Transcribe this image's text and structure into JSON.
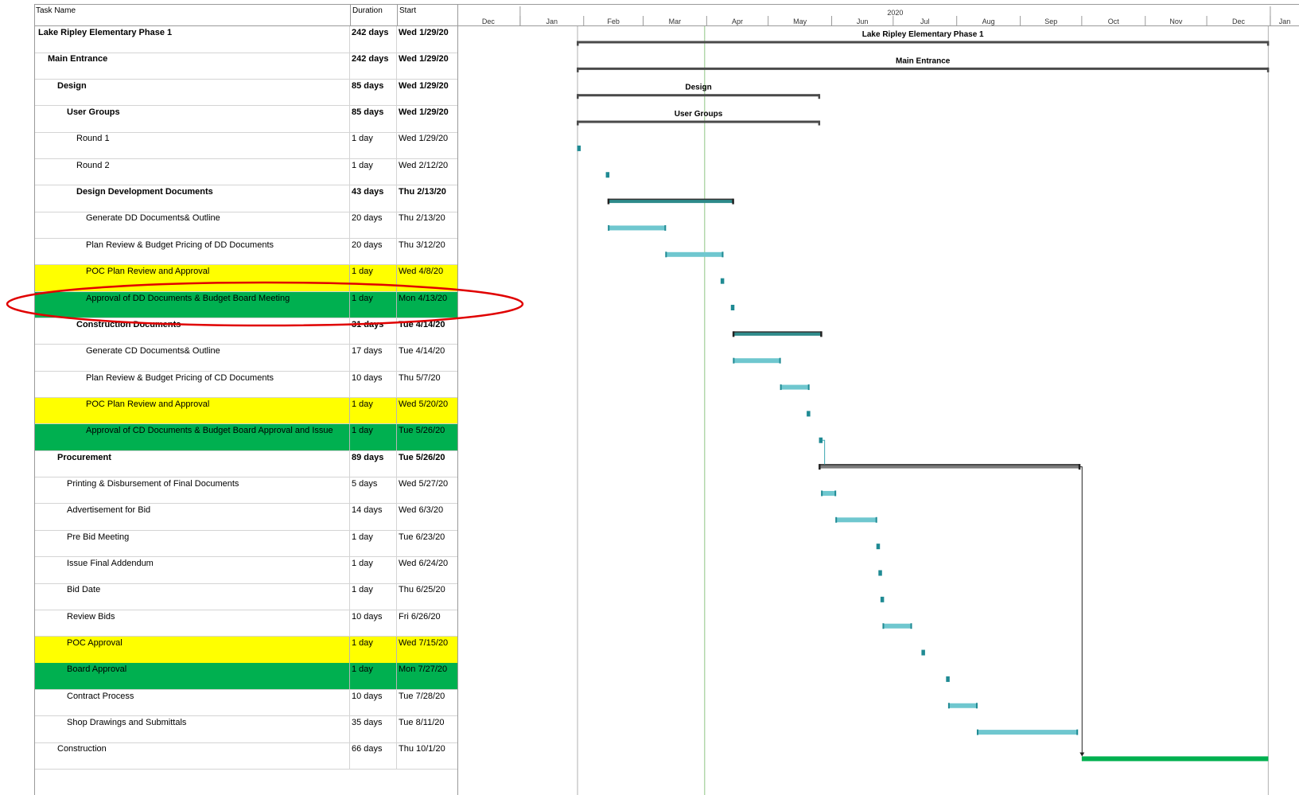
{
  "table": {
    "columns": {
      "name": "Task Name",
      "duration": "Duration",
      "start": "Start"
    },
    "rows": [
      {
        "name": "Lake Ripley Elementary Phase 1",
        "duration": "242 days",
        "start": "Wed 1/29/20",
        "level": 0,
        "bold": true,
        "highlight": ""
      },
      {
        "name": "Main Entrance",
        "duration": "242 days",
        "start": "Wed 1/29/20",
        "level": 1,
        "bold": true,
        "highlight": ""
      },
      {
        "name": "Design",
        "duration": "85 days",
        "start": "Wed 1/29/20",
        "level": 2,
        "bold": true,
        "highlight": ""
      },
      {
        "name": "User Groups",
        "duration": "85 days",
        "start": "Wed 1/29/20",
        "level": 3,
        "bold": true,
        "highlight": ""
      },
      {
        "name": "Round 1",
        "duration": "1 day",
        "start": "Wed 1/29/20",
        "level": 4,
        "bold": false,
        "highlight": ""
      },
      {
        "name": "Round 2",
        "duration": "1 day",
        "start": "Wed 2/12/20",
        "level": 4,
        "bold": false,
        "highlight": ""
      },
      {
        "name": "Design Development Documents",
        "duration": "43 days",
        "start": "Thu 2/13/20",
        "level": 4,
        "bold": true,
        "highlight": ""
      },
      {
        "name": "Generate DD Documents& Outline",
        "duration": "20 days",
        "start": "Thu 2/13/20",
        "level": 5,
        "bold": false,
        "highlight": ""
      },
      {
        "name": "Plan Review & Budget Pricing of DD Documents",
        "duration": "20 days",
        "start": "Thu 3/12/20",
        "level": 5,
        "bold": false,
        "highlight": ""
      },
      {
        "name": "POC Plan Review and Approval",
        "duration": "1 day",
        "start": "Wed 4/8/20",
        "level": 5,
        "bold": false,
        "highlight": "yellow"
      },
      {
        "name": "Approval of DD Documents & Budget Board Meeting",
        "duration": "1 day",
        "start": "Mon 4/13/20",
        "level": 5,
        "bold": false,
        "highlight": "green"
      },
      {
        "name": "Construction Documents",
        "duration": "31 days",
        "start": "Tue 4/14/20",
        "level": 4,
        "bold": true,
        "highlight": ""
      },
      {
        "name": "Generate CD Documents& Outline",
        "duration": "17 days",
        "start": "Tue 4/14/20",
        "level": 5,
        "bold": false,
        "highlight": ""
      },
      {
        "name": "Plan Review & Budget Pricing of CD Documents",
        "duration": "10 days",
        "start": "Thu 5/7/20",
        "level": 5,
        "bold": false,
        "highlight": ""
      },
      {
        "name": "POC Plan Review and Approval",
        "duration": "1 day",
        "start": "Wed 5/20/20",
        "level": 5,
        "bold": false,
        "highlight": "yellow"
      },
      {
        "name": "Approval of CD Documents & Budget Board Approval and Issue",
        "duration": "1 day",
        "start": "Tue 5/26/20",
        "level": 5,
        "bold": false,
        "highlight": "green"
      },
      {
        "name": "Procurement",
        "duration": "89 days",
        "start": "Tue 5/26/20",
        "level": 2,
        "bold": true,
        "highlight": ""
      },
      {
        "name": "Printing & Disbursement of Final Documents",
        "duration": "5 days",
        "start": "Wed 5/27/20",
        "level": 3,
        "bold": false,
        "highlight": ""
      },
      {
        "name": "Advertisement for Bid",
        "duration": "14 days",
        "start": "Wed 6/3/20",
        "level": 3,
        "bold": false,
        "highlight": ""
      },
      {
        "name": "Pre Bid Meeting",
        "duration": "1 day",
        "start": "Tue 6/23/20",
        "level": 3,
        "bold": false,
        "highlight": ""
      },
      {
        "name": "Issue Final Addendum",
        "duration": "1 day",
        "start": "Wed 6/24/20",
        "level": 3,
        "bold": false,
        "highlight": ""
      },
      {
        "name": "Bid Date",
        "duration": "1 day",
        "start": "Thu 6/25/20",
        "level": 3,
        "bold": false,
        "highlight": ""
      },
      {
        "name": "Review Bids",
        "duration": "10 days",
        "start": "Fri 6/26/20",
        "level": 3,
        "bold": false,
        "highlight": ""
      },
      {
        "name": "POC Approval",
        "duration": "1 day",
        "start": "Wed 7/15/20",
        "level": 3,
        "bold": false,
        "highlight": "yellow"
      },
      {
        "name": "Board Approval",
        "duration": "1 day",
        "start": "Mon 7/27/20",
        "level": 3,
        "bold": false,
        "highlight": "green"
      },
      {
        "name": "Contract Process",
        "duration": "10 days",
        "start": "Tue 7/28/20",
        "level": 3,
        "bold": false,
        "highlight": ""
      },
      {
        "name": "Shop Drawings and Submittals",
        "duration": "35 days",
        "start": "Tue 8/11/20",
        "level": 3,
        "bold": false,
        "highlight": ""
      },
      {
        "name": "Construction",
        "duration": "66 days",
        "start": "Thu 10/1/20",
        "level": 2,
        "bold": false,
        "highlight": ""
      }
    ]
  },
  "timescale": {
    "year_label": "2020",
    "months": [
      "Dec",
      "Jan",
      "Feb",
      "Mar",
      "Apr",
      "May",
      "Jun",
      "Jul",
      "Aug",
      "Sep",
      "Oct",
      "Nov",
      "Dec",
      "Jan"
    ],
    "range": [
      "2019-12-01",
      "2021-01-15"
    ],
    "today": "2020-03-31"
  },
  "chart_data": {
    "type": "gantt",
    "tasks": [
      {
        "name": "Lake Ripley Elementary Phase 1",
        "start": "2020-01-29",
        "end": "2020-12-31",
        "kind": "summary",
        "label": "Lake Ripley Elementary Phase 1"
      },
      {
        "name": "Main Entrance",
        "start": "2020-01-29",
        "end": "2020-12-31",
        "kind": "summary",
        "label": "Main Entrance"
      },
      {
        "name": "Design",
        "start": "2020-01-29",
        "end": "2020-05-26",
        "kind": "summary",
        "label": "Design"
      },
      {
        "name": "User Groups",
        "start": "2020-01-29",
        "end": "2020-05-26",
        "kind": "summary",
        "label": "User Groups"
      },
      {
        "name": "Round 1",
        "start": "2020-01-29",
        "end": "2020-01-30",
        "kind": "milestone"
      },
      {
        "name": "Round 2",
        "start": "2020-02-12",
        "end": "2020-02-13",
        "kind": "milestone"
      },
      {
        "name": "Design Development Documents",
        "start": "2020-02-13",
        "end": "2020-04-14",
        "kind": "group"
      },
      {
        "name": "Generate DD Documents& Outline",
        "start": "2020-02-13",
        "end": "2020-03-12",
        "kind": "task"
      },
      {
        "name": "Plan Review & Budget Pricing of DD Documents",
        "start": "2020-03-12",
        "end": "2020-04-09",
        "kind": "task"
      },
      {
        "name": "POC Plan Review and Approval",
        "start": "2020-04-08",
        "end": "2020-04-09",
        "kind": "milestone"
      },
      {
        "name": "Approval of DD Documents & Budget Board Meeting",
        "start": "2020-04-13",
        "end": "2020-04-14",
        "kind": "milestone"
      },
      {
        "name": "Construction Documents",
        "start": "2020-04-14",
        "end": "2020-05-27",
        "kind": "group"
      },
      {
        "name": "Generate CD Documents& Outline",
        "start": "2020-04-14",
        "end": "2020-05-07",
        "kind": "task"
      },
      {
        "name": "Plan Review & Budget Pricing of CD Documents",
        "start": "2020-05-07",
        "end": "2020-05-21",
        "kind": "task"
      },
      {
        "name": "POC Plan Review and Approval",
        "start": "2020-05-20",
        "end": "2020-05-21",
        "kind": "milestone"
      },
      {
        "name": "Approval of CD Documents & Budget Board Approval and Issue",
        "start": "2020-05-26",
        "end": "2020-05-27",
        "kind": "milestone"
      },
      {
        "name": "Procurement",
        "start": "2020-05-26",
        "end": "2020-09-30",
        "kind": "group"
      },
      {
        "name": "Printing & Disbursement of Final Documents",
        "start": "2020-05-27",
        "end": "2020-06-03",
        "kind": "task"
      },
      {
        "name": "Advertisement for Bid",
        "start": "2020-06-03",
        "end": "2020-06-23",
        "kind": "task"
      },
      {
        "name": "Pre Bid Meeting",
        "start": "2020-06-23",
        "end": "2020-06-24",
        "kind": "milestone"
      },
      {
        "name": "Issue Final Addendum",
        "start": "2020-06-24",
        "end": "2020-06-25",
        "kind": "milestone"
      },
      {
        "name": "Bid Date",
        "start": "2020-06-25",
        "end": "2020-06-26",
        "kind": "milestone"
      },
      {
        "name": "Review Bids",
        "start": "2020-06-26",
        "end": "2020-07-10",
        "kind": "task"
      },
      {
        "name": "POC Approval",
        "start": "2020-07-15",
        "end": "2020-07-16",
        "kind": "milestone"
      },
      {
        "name": "Board Approval",
        "start": "2020-07-27",
        "end": "2020-07-28",
        "kind": "milestone"
      },
      {
        "name": "Contract Process",
        "start": "2020-07-28",
        "end": "2020-08-11",
        "kind": "task"
      },
      {
        "name": "Shop Drawings and Submittals",
        "start": "2020-08-11",
        "end": "2020-09-29",
        "kind": "task"
      },
      {
        "name": "Construction",
        "start": "2020-10-01",
        "end": "2020-12-31",
        "kind": "construction"
      }
    ]
  },
  "colors": {
    "summary": "#4a4a4a",
    "group": "#2e8b8b",
    "task": "#6fc7cf",
    "task_cap": "#1f8a93",
    "milestone": "#1f8a93",
    "construction": "#00b050",
    "highlight_yellow": "#ffff00",
    "highlight_green": "#00b050",
    "today_line": "#a9d3a0",
    "annotation": "#e00000"
  },
  "annotation": {
    "shape": "ellipse",
    "target_row": 10
  }
}
